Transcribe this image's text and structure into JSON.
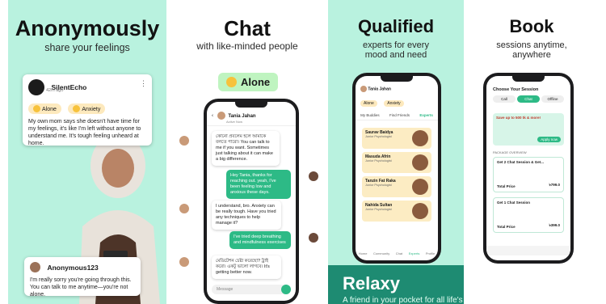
{
  "panels": {
    "anon": {
      "title": "Anonymously",
      "subtitle": "share your feelings",
      "post1": {
        "user": "SilentEcho",
        "time": "42m ago",
        "tags": [
          "Alone",
          "Anxiety"
        ],
        "text": "My own mom says she doesn't have time for my feelings, it's like I'm left without anyone to understand me. It's tough feeling unheard at home."
      },
      "post2": {
        "user": "Anonymous123",
        "text": "I'm really sorry you're going through this. You can talk to me anytime—you're not alone."
      }
    },
    "chat": {
      "title": "Chat",
      "subtitle": "with like-minded people",
      "mood": "Alone",
      "contact": "Tania Jahan",
      "status": "Active Now",
      "messages": [
        "কোনো প্রবলেম হলে আমাকে বলতে পারো। You can talk to me if you want. Sometimes just talking about it can make a big difference.",
        "Hey Tania, thanks for reaching out. yeah, I've been feeling low and anxious these days.",
        "I understand, bro. Anxiety can be really tough. Have you tried any techniques to help manage it?",
        "I've tried deep breathing and mindfulness exercises",
        "মেডিটেশন চেষ্টা করেছো? ট্রাই করো। একটু ভালো লাগবে। It's getting better now."
      ],
      "input_placeholder": "Message"
    },
    "qualified": {
      "title": "Qualified",
      "subtitle": "experts for every mood and need",
      "user": "Tania Jahan",
      "tags": [
        "Alone",
        "Anxiety"
      ],
      "tabs": [
        "My Buddies",
        "Find Friends",
        "Experts"
      ],
      "experts": [
        {
          "name": "Saurav Baidya",
          "role": "Junior Psychologist"
        },
        {
          "name": "Masuda Afrin",
          "role": "Junior Psychologist"
        },
        {
          "name": "Tanzin Fat Raka",
          "role": "Junior Psychologist"
        },
        {
          "name": "Nahida Sultan",
          "role": "Junior Psychologist"
        }
      ],
      "nav": [
        "Home",
        "Community",
        "Chat",
        "Experts",
        "Profile"
      ],
      "brand": "Relaxy",
      "brand_tagline": "A friend in your pocket for all life's ups and downs"
    },
    "book": {
      "title": "Book",
      "subtitle": "sessions anytime, anywhere",
      "screen_title": "Choose Your Session",
      "segments": [
        "Call",
        "Chat",
        "Offline"
      ],
      "promo": "Save up to 500 tk & more!",
      "promo_button": "Apply now",
      "package_label": "PACKAGE OVERVIEW",
      "packages": [
        {
          "name": "Get 2 Chat Session & Get...",
          "total_label": "Total Price",
          "price": "৳799.0"
        },
        {
          "name": "Get 1 Chat Session",
          "total_label": "Total Price",
          "price": "৳399.0"
        }
      ]
    }
  },
  "colors": {
    "mint": "#b9f2df",
    "green": "#2dba86",
    "teal": "#1e8b72",
    "chip": "#fde9bd"
  }
}
